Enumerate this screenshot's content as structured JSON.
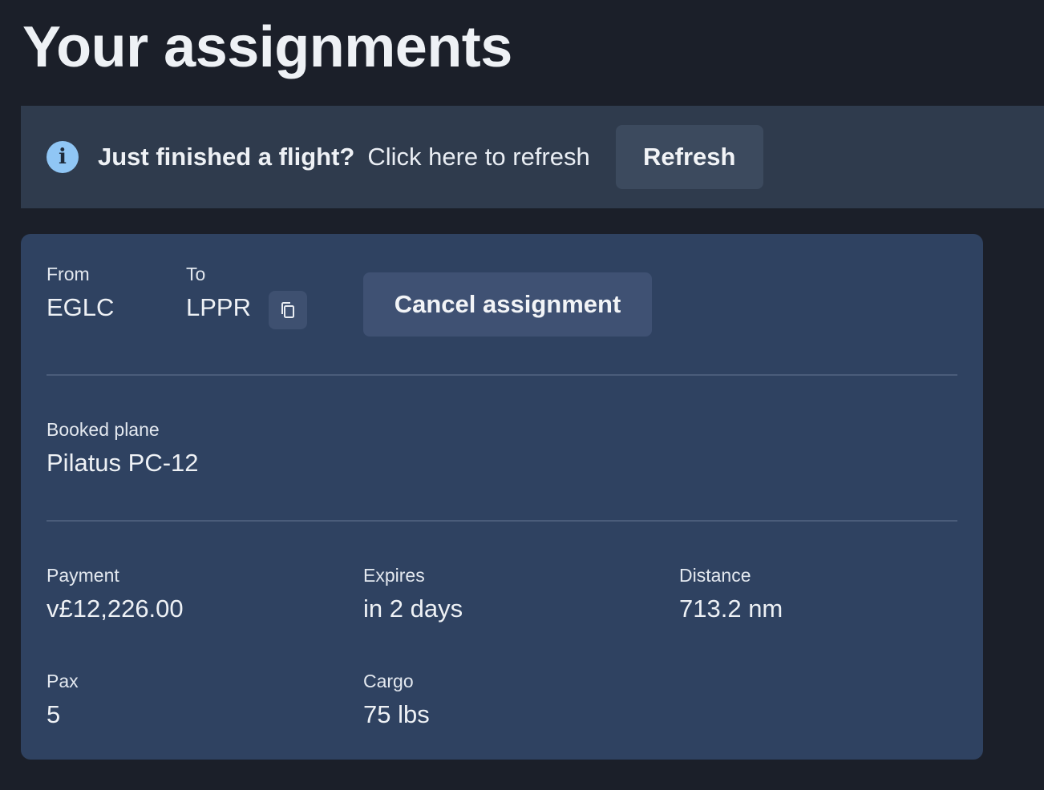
{
  "page": {
    "title": "Your assignments"
  },
  "banner": {
    "title": "Just finished a flight?",
    "description": "Click here to refresh",
    "refresh_label": "Refresh",
    "icon": "info-icon"
  },
  "assignment": {
    "from_label": "From",
    "from_value": "EGLC",
    "to_label": "To",
    "to_value": "LPPR",
    "copy_icon": "copy-icon",
    "cancel_label": "Cancel assignment",
    "plane_label": "Booked plane",
    "plane_value": "Pilatus PC-12",
    "payment_label": "Payment",
    "payment_value": "v£12,226.00",
    "expires_label": "Expires",
    "expires_value": "in 2 days",
    "distance_label": "Distance",
    "distance_value": "713.2 nm",
    "pax_label": "Pax",
    "pax_value": "5",
    "cargo_label": "Cargo",
    "cargo_value": "75 lbs"
  },
  "colors": {
    "background": "#1b1f29",
    "banner": "#2f3b4d",
    "card": "#2f4261",
    "info_icon": "#90c6f5"
  }
}
